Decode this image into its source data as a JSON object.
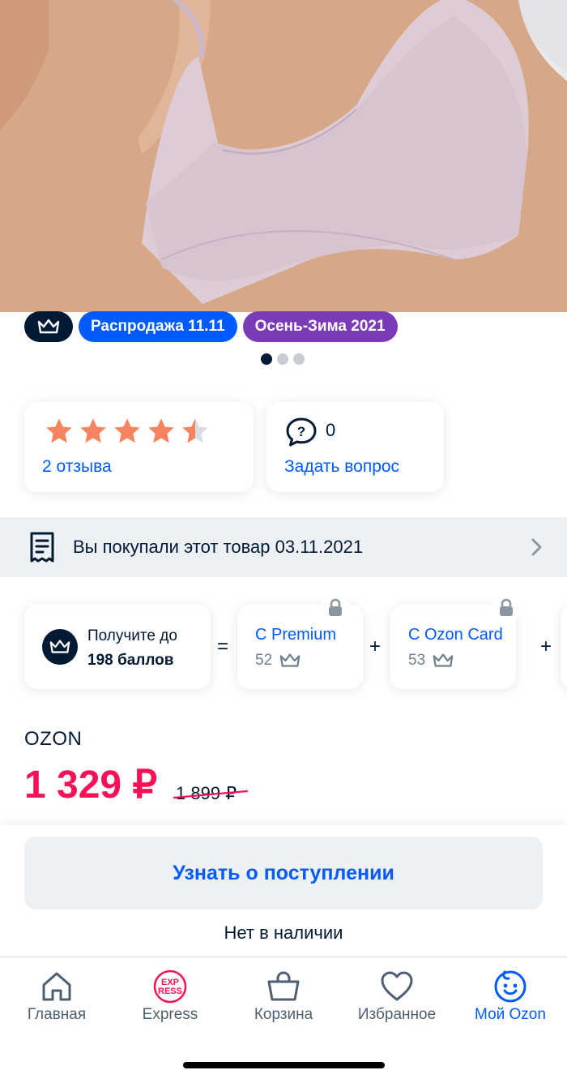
{
  "badges": {
    "crown_icon": "crown-icon",
    "sale": "Распродажа 11.11",
    "season": "Осень-Зима 2021"
  },
  "gallery": {
    "total": 3,
    "active": 1
  },
  "rating": {
    "stars": 4.5,
    "reviews": "2 отзыва"
  },
  "questions": {
    "count": "0",
    "ask": "Задать вопрос"
  },
  "purchased": {
    "text": "Вы покупали этот товар 03.11.2021"
  },
  "bonus": {
    "line1": "Получите до",
    "line2": "198 баллов",
    "eq": "=",
    "plus": "+",
    "premium": {
      "title": "С Premium",
      "points": "52"
    },
    "ozon_card": {
      "title": "С Ozon Card",
      "points": "53"
    }
  },
  "product": {
    "brand": "OZON",
    "price": "1 329 ₽",
    "old_price": "1 899 ₽"
  },
  "actions": {
    "notify": "Узнать о поступлении",
    "stock": "Нет в наличии"
  },
  "tabbar": {
    "items": [
      {
        "label": "Главная",
        "icon": "home-icon"
      },
      {
        "label": "Express",
        "icon": "express-icon"
      },
      {
        "label": "Корзина",
        "icon": "basket-icon"
      },
      {
        "label": "Избранное",
        "icon": "heart-icon"
      },
      {
        "label": "Мой Ozon",
        "icon": "profile-face-icon",
        "active": true
      }
    ]
  },
  "colors": {
    "accent": "#005bff",
    "price": "#f91155",
    "season_badge": "#7b3ab6",
    "star": "#f4845f"
  }
}
